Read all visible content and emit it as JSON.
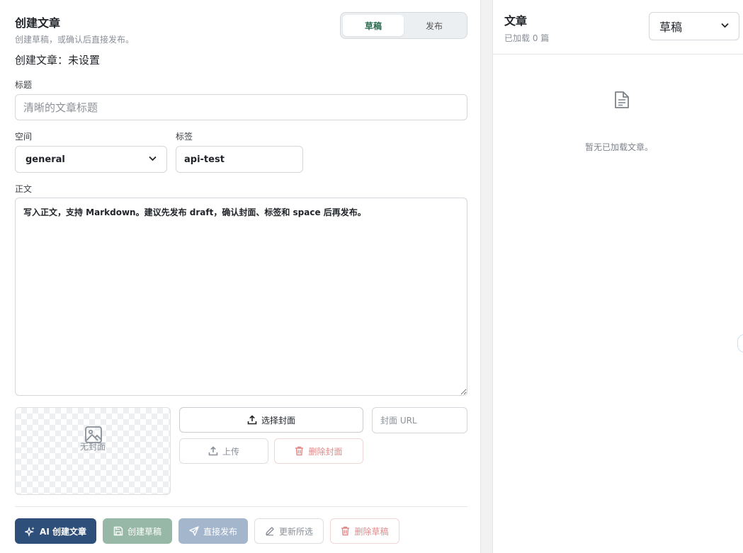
{
  "editor": {
    "heading": "创建文章",
    "subheading": "创建草稿，或确认后直接发布。",
    "status_line": "创建文章：未设置",
    "mode_tabs": [
      "草稿",
      "发布"
    ],
    "active_mode": "草稿",
    "title_label": "标题",
    "title_placeholder": "清晰的文章标题",
    "space_label": "空间",
    "space_value": "general",
    "tags_label": "标签",
    "tags_value": "api-test",
    "body_label": "正文",
    "body_value": "写入正文，支持 Markdown。建议先发布 draft，确认封面、标签和 space 后再发布。",
    "cover": {
      "empty_text": "无封面",
      "choose_label": "选择封面",
      "url_placeholder": "封面 URL",
      "upload_label": "上传",
      "delete_label": "删除封面"
    },
    "actions": {
      "ai_create": "AI 创建文章",
      "create_draft": "创建草稿",
      "publish_direct": "直接发布",
      "update_selected": "更新所选",
      "delete_draft": "删除草稿"
    }
  },
  "articles": {
    "heading": "文章",
    "loaded_count": "已加载 0 篇",
    "filter_value": "草稿",
    "empty_text": "暂无已加载文章。"
  },
  "colors": {
    "primary": "#2e4f7a",
    "draft_button": "#97b8a6",
    "publish_button": "#a4b6cb",
    "active_tab_text": "#2a6b4f",
    "danger_muted": "#e08a8a"
  },
  "icons": [
    "image-icon",
    "upload-icon",
    "trash-icon",
    "sparkle-icon",
    "save-icon",
    "send-icon",
    "pencil-icon",
    "document-icon",
    "chevron-down-icon"
  ]
}
